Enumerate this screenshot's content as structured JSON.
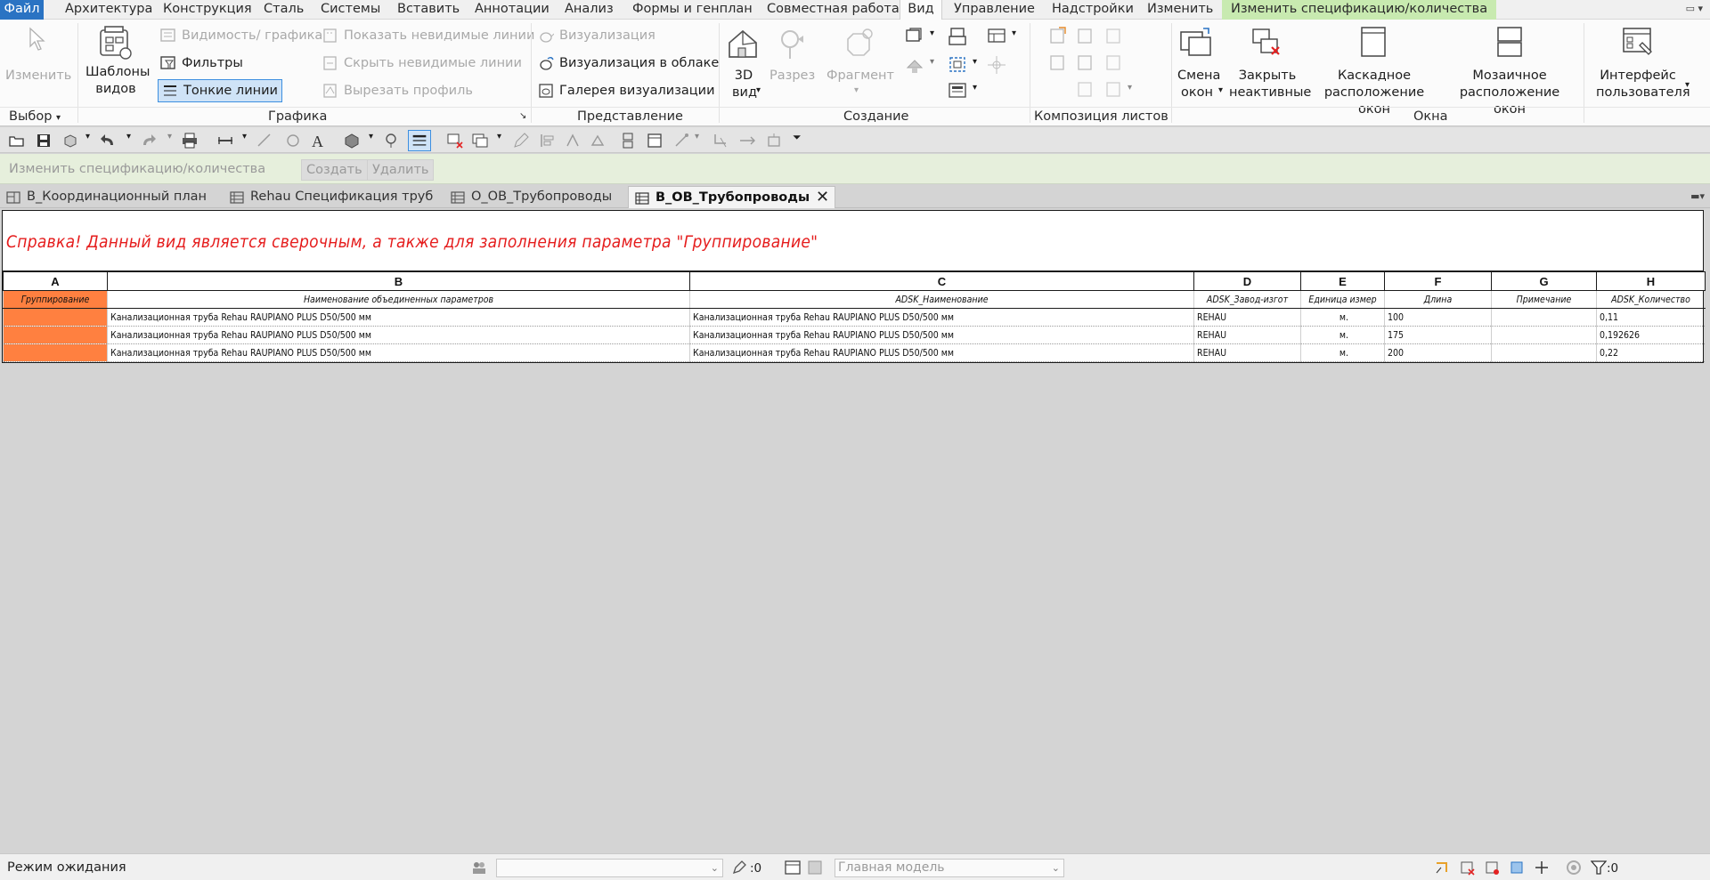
{
  "ribbon_tabs": [
    "Файл",
    "Архитектура",
    "Конструкция",
    "Сталь",
    "Системы",
    "Вставить",
    "Аннотации",
    "Анализ",
    "Формы и генплан",
    "Совместная работа",
    "Вид",
    "Управление",
    "Надстройки",
    "Изменить",
    "Изменить спецификацию/количества"
  ],
  "ribbon": {
    "select": {
      "modify": "Изменить",
      "title": "Выбор"
    },
    "graphics": {
      "view_templates": "Шаблоны видов",
      "visibility": "Видимость/ графика",
      "filters": "Фильтры",
      "thin_lines": "Тонкие линии",
      "show_hidden": "Показать невидимые линии",
      "remove_hidden": "Скрыть невидимые линии",
      "cut_profile": "Вырезать профиль",
      "title": "Графика"
    },
    "presentation": {
      "render": "Визуализация",
      "render_cloud": "Визуализация  в облаке",
      "render_gallery": "Галерея  визуализации",
      "title": "Представление"
    },
    "create": {
      "view3d": "3D вид",
      "section": "Разрез",
      "callout": "Фрагмент",
      "title": "Создание"
    },
    "sheet_composition": {
      "title": "Композиция листов"
    },
    "windows": {
      "switch": "Смена окон",
      "close_inactive": "Закрыть неактивные",
      "cascade": "Каскадное расположение окон",
      "tile": "Мозаичное расположение окон",
      "title": "Окна"
    },
    "ui": {
      "label": "Интерфейс пользователя"
    }
  },
  "context_bar": {
    "title": "Изменить спецификацию/количества",
    "create": "Создать",
    "delete": "Удалить"
  },
  "view_tabs": [
    {
      "label": "В_Координационный план"
    },
    {
      "label": "Rehau Спецификация труб"
    },
    {
      "label": "О_ОВ_Трубопроводы"
    },
    {
      "label": "В_ОВ_Трубопроводы"
    }
  ],
  "schedule": {
    "title": "Справка! Данный вид является сверочным, а также для заполнения параметра \"Группирование\"",
    "column_letters": [
      "A",
      "B",
      "C",
      "D",
      "E",
      "F",
      "G",
      "H"
    ],
    "headers": [
      "Группирование",
      "Наименование объединенных параметров",
      "ADSK_Наименование",
      "ADSK_Завод-изгот",
      "Единица измер",
      "Длина",
      "Примечание",
      "ADSK_Количество"
    ],
    "rows": [
      [
        "",
        "Канализационная труба Rehau RAUPIANO PLUS D50/500 мм",
        "Канализационная труба Rehau RAUPIANO PLUS D50/500 мм",
        "REHAU",
        "м.",
        "100",
        "",
        "0,11"
      ],
      [
        "",
        "Канализационная труба Rehau RAUPIANO PLUS D50/500 мм",
        "Канализационная труба Rehau RAUPIANO PLUS D50/500 мм",
        "REHAU",
        "м.",
        "175",
        "",
        "0,192626"
      ],
      [
        "",
        "Канализационная труба Rehau RAUPIANO PLUS D50/500 мм",
        "Канализационная труба Rehau RAUPIANO PLUS D50/500 мм",
        "REHAU",
        "м.",
        "200",
        "",
        "0,22"
      ]
    ]
  },
  "status_bar": {
    "status": "Режим ожидания",
    "worksets_count": ":0",
    "model": "Главная модель",
    "filter_count": ":0"
  },
  "colors": {
    "accent": "#2a73c3",
    "context_tab": "#c8eab0",
    "grouping_cell": "#ff8040",
    "title_text": "#e51c1c"
  }
}
